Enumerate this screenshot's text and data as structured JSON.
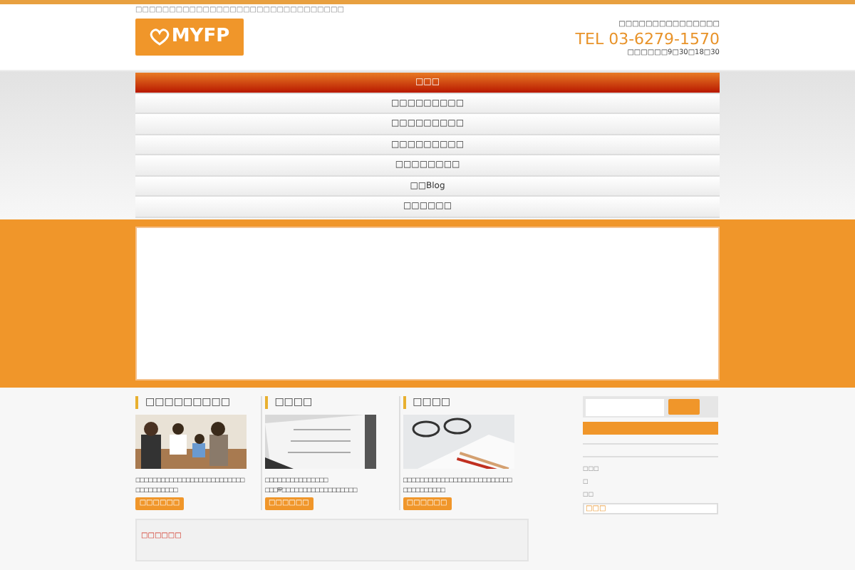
{
  "header": {
    "tagline": "□□□□□□□□□□□□□□□□□□□□□□□□□□□□□□□",
    "logo": "MYFP",
    "contact_label": "□□□□□□□□□□□□□□□",
    "phone": "TEL 03-6279-1570",
    "hours": "□□□□□□9□30□18□30"
  },
  "nav": [
    {
      "label": "□□□",
      "selected": true
    },
    {
      "label": "□□□□□□□□□",
      "selected": false
    },
    {
      "label": "□□□□□□□□□",
      "selected": false
    },
    {
      "label": "□□□□□□□□□",
      "selected": false
    },
    {
      "label": "□□□□□□□□",
      "selected": false
    },
    {
      "label": "□□Blog",
      "selected": false
    },
    {
      "label": "□□□□□□",
      "selected": false
    }
  ],
  "cards": [
    {
      "title": "□□□□□□□□□",
      "lines": [
        "□□□□□□□□□□□□□□□□□□□□□□□□□□",
        "□□□□□□□□□□"
      ],
      "button": "□□□□□□"
    },
    {
      "title": "□□□□",
      "lines": [
        "□□□□□□□□□□□□□□□",
        "□□□FP□□□□□□□□□□□□□□□□□□"
      ],
      "button": "□□□□□□"
    },
    {
      "title": "□□□□",
      "lines": [
        "□□□□□□□□□□□□□□□□□□□□□□□□□□",
        "□□□□□□□□□□"
      ],
      "button": "□□□□□□"
    }
  ],
  "news_heading": "□□□□□□",
  "sidebar": {
    "small_texts": [
      "□□□",
      "□",
      "□□"
    ],
    "field_value": "□□□"
  }
}
